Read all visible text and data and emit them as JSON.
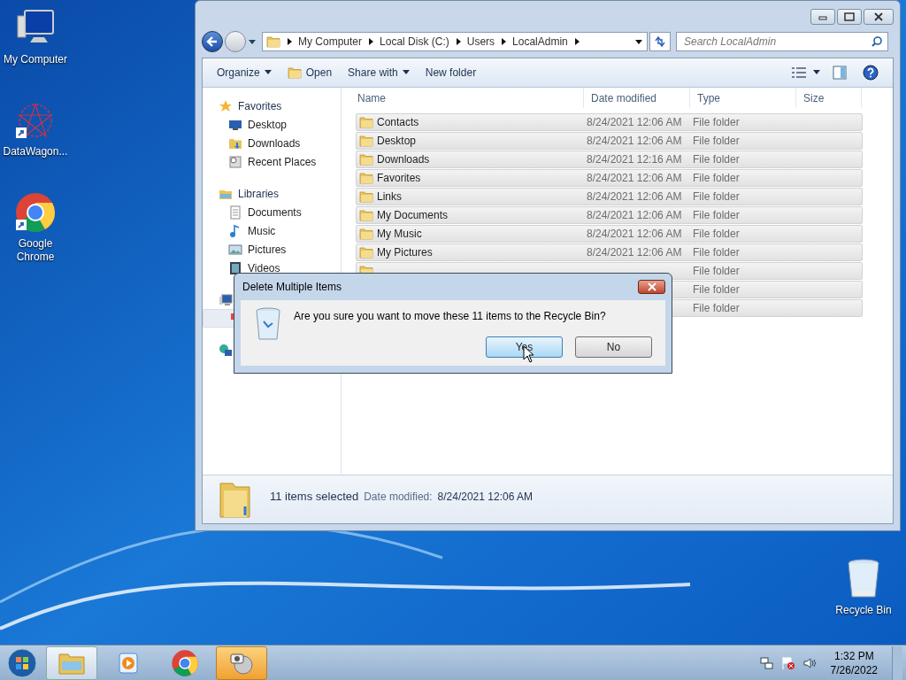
{
  "desktop_icons": [
    {
      "label": "My Computer",
      "kind": "computer"
    },
    {
      "label": "DataWagon...",
      "kind": "app"
    },
    {
      "label": "Google Chrome",
      "kind": "chrome"
    },
    {
      "label": "Recycle Bin",
      "kind": "recycle"
    }
  ],
  "explorer": {
    "breadcrumb": [
      "My Computer",
      "Local Disk (C:)",
      "Users",
      "LocalAdmin"
    ],
    "search": {
      "placeholder": "Search LocalAdmin"
    },
    "toolbar": [
      {
        "label": "Organize",
        "kind": "menu"
      },
      {
        "label": "Open",
        "kind": "open"
      },
      {
        "label": "Share with",
        "kind": "menu"
      },
      {
        "label": "New folder",
        "kind": "plain"
      }
    ],
    "nav": [
      {
        "label": "Favorites",
        "kind": "star",
        "children": [
          {
            "label": "Desktop",
            "kind": "desktop"
          },
          {
            "label": "Downloads",
            "kind": "downloads"
          },
          {
            "label": "Recent Places",
            "kind": "recent"
          }
        ]
      },
      {
        "label": "Libraries",
        "kind": "library",
        "children": [
          {
            "label": "Documents",
            "kind": "document"
          },
          {
            "label": "Music",
            "kind": "music"
          },
          {
            "label": "Pictures",
            "kind": "picture"
          },
          {
            "label": "Videos",
            "kind": "video"
          }
        ]
      },
      {
        "kind": "computer",
        "children": [
          {
            "kind": "drive",
            "selected": true
          }
        ]
      },
      {
        "kind": "network"
      }
    ],
    "columns": [
      "Name",
      "Date modified",
      "Type",
      "Size"
    ],
    "rows": [
      {
        "name": "Contacts",
        "date": "8/24/2021 12:06 AM",
        "type": "File folder",
        "selected": true
      },
      {
        "name": "Desktop",
        "date": "8/24/2021 12:06 AM",
        "type": "File folder",
        "selected": true
      },
      {
        "name": "Downloads",
        "date": "8/24/2021 12:16 AM",
        "type": "File folder",
        "selected": true
      },
      {
        "name": "Favorites",
        "date": "8/24/2021 12:06 AM",
        "type": "File folder",
        "selected": true
      },
      {
        "name": "Links",
        "date": "8/24/2021 12:06 AM",
        "type": "File folder",
        "selected": true
      },
      {
        "name": "My Documents",
        "date": "8/24/2021 12:06 AM",
        "type": "File folder",
        "selected": true
      },
      {
        "name": "My Music",
        "date": "8/24/2021 12:06 AM",
        "type": "File folder",
        "selected": true
      },
      {
        "name": "My Pictures",
        "date": "8/24/2021 12:06 AM",
        "type": "File folder",
        "selected": true
      },
      {
        "type": "File folder",
        "selected": true
      },
      {
        "type": "File folder",
        "selected": true
      },
      {
        "type": "File folder",
        "selected": true
      }
    ],
    "status": {
      "count": "11 items selected",
      "label": "Date modified:",
      "value": "8/24/2021 12:06 AM"
    }
  },
  "dialog": {
    "title": "Delete Multiple Items",
    "message": "Are you sure you want to move these 11 items to the Recycle Bin?",
    "buttons": [
      {
        "label": "Yes",
        "selected": true
      },
      {
        "label": "No",
        "selected": false
      }
    ]
  },
  "taskbar": {
    "apps": [
      {
        "kind": "explorer",
        "selected": true,
        "flashing": false
      },
      {
        "kind": "media",
        "selected": false,
        "flashing": false
      },
      {
        "kind": "chrome",
        "selected": false,
        "flashing": false
      },
      {
        "kind": "tool",
        "selected": false,
        "flashing": true
      }
    ],
    "clock": {
      "time": "1:32 PM",
      "date": "7/26/2022"
    }
  }
}
